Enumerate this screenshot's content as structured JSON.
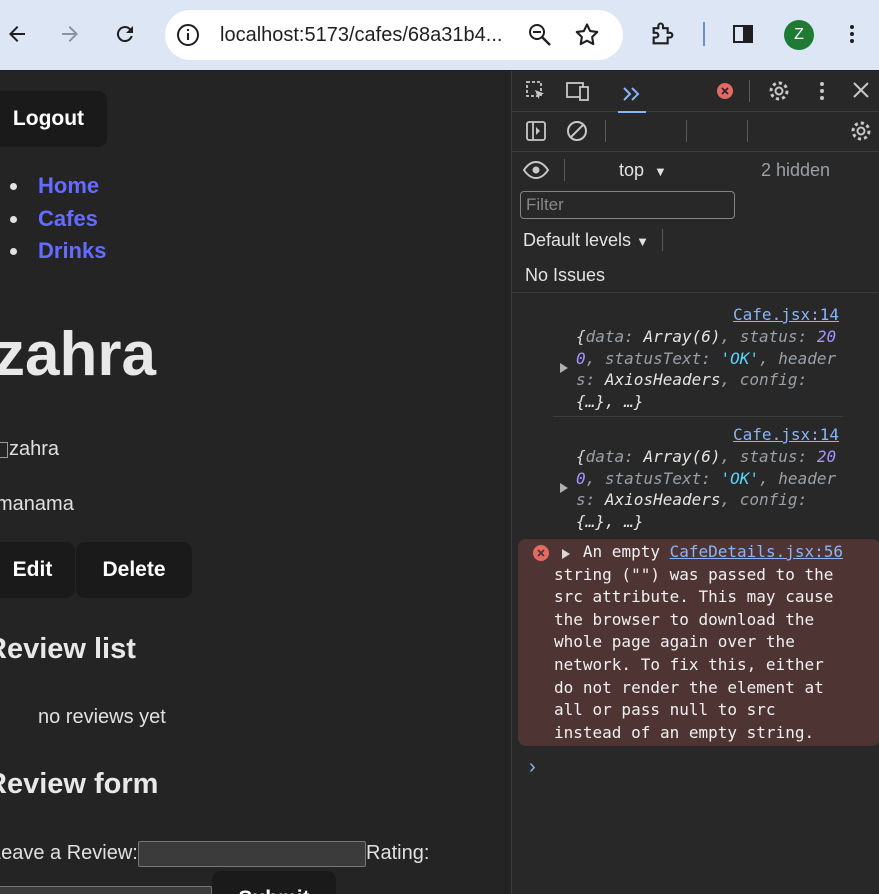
{
  "browser": {
    "url": "localhost:5173/cafes/68a31b4...",
    "profile_initial": "Z",
    "icons": {
      "back": "arrow-left-icon",
      "forward": "arrow-right-icon",
      "reload": "reload-icon",
      "site_info": "info-icon",
      "zoom": "zoom-icon",
      "bookmark": "star-icon",
      "extensions": "puzzle-icon",
      "side_panel": "side-panel-icon",
      "menu": "kebab-menu-icon"
    }
  },
  "page": {
    "logout_label": "Logout",
    "nav": [
      "Home",
      "Cafes",
      "Drinks"
    ],
    "cafe_name": "zahra",
    "image_alt": "zahra",
    "location": "manama",
    "edit_label": "Edit",
    "delete_label": "Delete",
    "review_list_heading": "Review list",
    "no_reviews": "no reviews yet",
    "review_form_heading": "Review form",
    "leave_review_label": "Leave a Review:",
    "rating_label": "Rating:",
    "submit_label": "Submit",
    "link_color": "#646cff"
  },
  "devtools": {
    "context": "top",
    "hidden_count": "2 hidden",
    "filter_placeholder": "Filter",
    "levels_label": "Default levels",
    "issues_label": "No Issues",
    "messages": [
      {
        "source": "Cafe.jsx:14",
        "text_lines": [
          [
            "{",
            "data: ",
            "Array(6)",
            ", status: ",
            "20"
          ],
          [
            "0",
            ", statusText: ",
            "'OK'",
            ", header"
          ],
          [
            "s: ",
            "AxiosHeaders",
            ", config:"
          ],
          [
            "{…}, …}"
          ]
        ]
      },
      {
        "source": "Cafe.jsx:14",
        "text_lines": [
          [
            "{",
            "data: ",
            "Array(6)",
            ", status: ",
            "20"
          ],
          [
            "0",
            ", statusText: ",
            "'OK'",
            ", header"
          ],
          [
            "s: ",
            "AxiosHeaders",
            ", config:"
          ],
          [
            "{…}, …}"
          ]
        ]
      }
    ],
    "error": {
      "source": "CafeDetails.jsx:56",
      "first_line": "An empty ",
      "lines": [
        "string (\"\") was passed to the",
        "src attribute. This may cause",
        "the browser to download the",
        "whole page again over the",
        "network. To fix this, either",
        "do not render the element at",
        "all or pass null to src",
        "instead of an empty string."
      ]
    },
    "prompt": "›",
    "colors": {
      "error_bg": "#4e3534",
      "link": "#8ab4f8"
    }
  }
}
